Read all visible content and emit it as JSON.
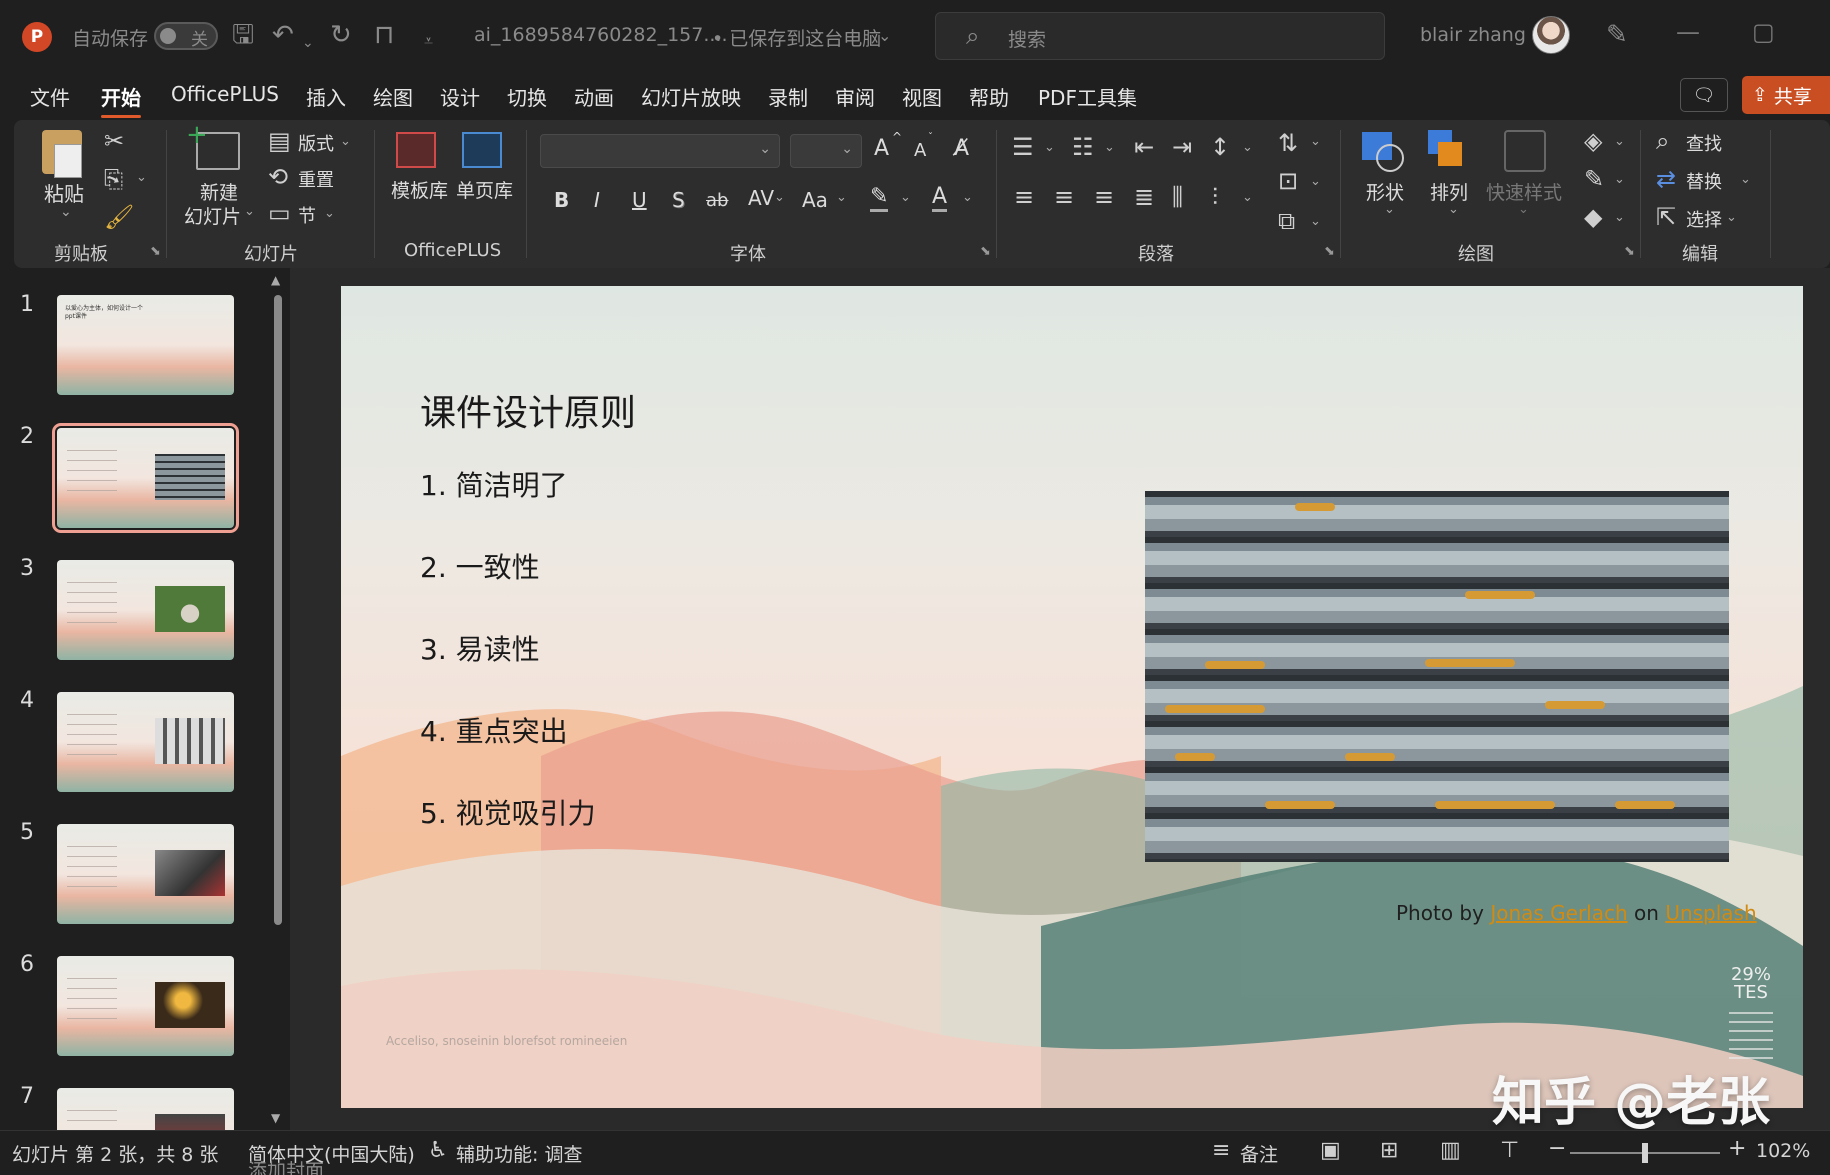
{
  "titlebar": {
    "autosave_label": "自动保存",
    "autosave_state": "关",
    "filename": "ai_1689584760282_157....",
    "save_status": "• 已保存到这台电脑",
    "search_placeholder": "搜索",
    "user_name": "blair zhang"
  },
  "menu": {
    "tabs": [
      "文件",
      "开始",
      "OfficePLUS",
      "插入",
      "绘图",
      "设计",
      "切换",
      "动画",
      "幻灯片放映",
      "录制",
      "审阅",
      "视图",
      "帮助",
      "PDF工具集"
    ],
    "active": "开始",
    "share": "共享"
  },
  "ribbon": {
    "clipboard": {
      "paste": "粘贴",
      "group": "剪贴板"
    },
    "slides": {
      "new_slide_1": "新建",
      "new_slide_2": "幻灯片",
      "layout": "版式",
      "reset": "重置",
      "section": "节",
      "group": "幻灯片"
    },
    "officeplus": {
      "template": "模板库",
      "single_page": "单页库",
      "group": "OfficePLUS"
    },
    "font": {
      "group": "字体",
      "bold": "B",
      "italic": "I",
      "underline": "U",
      "shadow": "S",
      "strike": "ab",
      "spacing": "AV",
      "case": "Aa",
      "grow": "A",
      "shrink": "A"
    },
    "paragraph": {
      "group": "段落"
    },
    "drawing": {
      "shape": "形状",
      "arrange": "排列",
      "quick_style": "快速样式",
      "group": "绘图"
    },
    "editing": {
      "find": "查找",
      "replace": "替换",
      "select": "选择",
      "group": "编辑"
    }
  },
  "thumbnails": {
    "numbers": [
      "1",
      "2",
      "3",
      "4",
      "5",
      "6",
      "7"
    ],
    "slide1_title": "以爱心为主体，如何设计一个ppt课件",
    "selected": 2
  },
  "slide": {
    "title": "课件设计原则",
    "bullets": [
      "1. 简洁明了",
      "2. 一致性",
      "3. 易读性",
      "4. 重点突出",
      "5. 视觉吸引力"
    ],
    "credit_prefix": "Photo by",
    "credit_author": "Jonas Gerlach",
    "credit_mid": "on",
    "credit_site": "Unsplash",
    "faint_caption": "Acceliso, snoseinin blorefsot romineeien",
    "deco_text": "29%\nTES",
    "watermark": "知乎 @老张"
  },
  "statusbar": {
    "slide_info": "幻灯片 第 2 张，共 8 张",
    "language": "简体中文(中国大陆)",
    "accessibility": "辅助功能: 调查",
    "notes": "备注",
    "zoom": "102%",
    "peek": "添加封面"
  },
  "colors": {
    "accent": "#e05a2b",
    "share": "#c94f23",
    "link": "#d18a12"
  }
}
